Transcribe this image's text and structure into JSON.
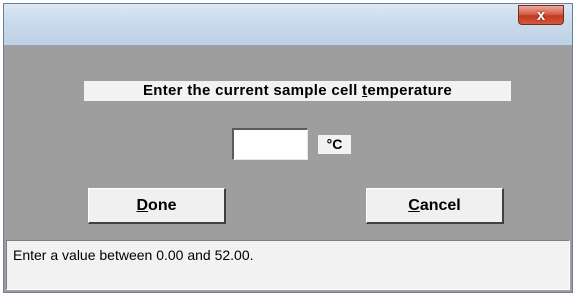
{
  "window": {
    "close_glyph": "x",
    "close_icon": "close-icon"
  },
  "dialog": {
    "prompt_prefix": "Enter the current sample cell ",
    "prompt_mnemonic": "t",
    "prompt_suffix": "emperature",
    "temperature_value": "",
    "unit": "°C",
    "done_mnemonic": "D",
    "done_rest": "one",
    "cancel_mnemonic": "C",
    "cancel_rest": "ancel"
  },
  "status_bar": {
    "message": "Enter a value between 0.00 and 52.00."
  },
  "colors": {
    "dialog_background": "#9e9e9e",
    "close_button": "#c3391f",
    "title_bar": "#c9daec"
  }
}
